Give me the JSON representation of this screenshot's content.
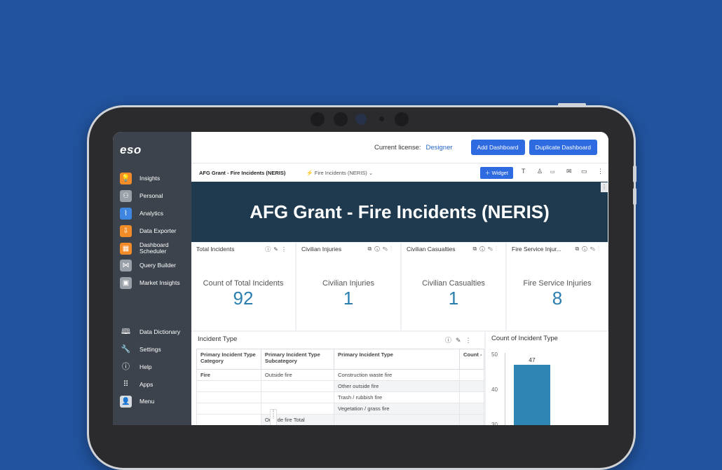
{
  "sidebar": {
    "logo": "eso",
    "items": [
      {
        "label": "Insights",
        "icon": "lightbulb-icon",
        "color": "#f28c28"
      },
      {
        "label": "Personal",
        "icon": "person-icon",
        "color": "#9aa0a8"
      },
      {
        "label": "Analytics",
        "icon": "analytics-icon",
        "color": "#3f86e0"
      },
      {
        "label": "Data Exporter",
        "icon": "export-icon",
        "color": "#f28c28"
      },
      {
        "label": "Dashboard Scheduler",
        "icon": "scheduler-icon",
        "color": "#f28c28"
      },
      {
        "label": "Query Builder",
        "icon": "query-icon",
        "color": "#9aa0a8"
      },
      {
        "label": "Market Insights",
        "icon": "market-icon",
        "color": "#9aa0a8"
      }
    ],
    "bottom_items": [
      {
        "label": "Data Dictionary",
        "icon": "book-icon"
      },
      {
        "label": "Settings",
        "icon": "wrench-icon"
      },
      {
        "label": "Help",
        "icon": "help-icon"
      },
      {
        "label": "Apps",
        "icon": "grid-icon"
      },
      {
        "label": "Menu",
        "icon": "avatar-icon"
      }
    ]
  },
  "topbar": {
    "license_label": "Current license:",
    "license_value": "Designer",
    "add_dashboard": "Add Dashboard",
    "duplicate_dashboard": "Duplicate Dashboard"
  },
  "tabbar": {
    "dashboard_title": "AFG Grant - Fire Incidents (NERIS)",
    "subtab": "Fire Incidents (NERIS)",
    "widget_button": "Widget"
  },
  "banner": {
    "title": "AFG Grant - Fire Incidents (NERIS)"
  },
  "kpis": [
    {
      "header": "Total Incidents",
      "label": "Count of Total Incidents",
      "value": "92"
    },
    {
      "header": "Civilian Injuries",
      "label": "Civilian Injuries",
      "value": "1"
    },
    {
      "header": "Civilian Casualties",
      "label": "Civilian Casualties",
      "value": "1"
    },
    {
      "header": "Fire Service Injur...",
      "label": "Fire Service Injuries",
      "value": "8"
    }
  ],
  "incident_table": {
    "title": "Incident Type",
    "columns": [
      "Primary Incident Type Category",
      "Primary Incident Type Subcategory",
      "Primary Incident Type",
      "Count - Incider"
    ],
    "rows": [
      {
        "category": "Fire",
        "subcategory": "Outside fire",
        "type": "Construction waste fire"
      },
      {
        "category": "",
        "subcategory": "",
        "type": "Other outside fire"
      },
      {
        "category": "",
        "subcategory": "",
        "type": "Trash / rubbish fire"
      },
      {
        "category": "",
        "subcategory": "",
        "type": "Vegetation / grass fire"
      },
      {
        "category": "",
        "subcategory": "Outside fire Total",
        "type": ""
      }
    ]
  },
  "chart_data": {
    "type": "bar",
    "title": "Count of Incident Type",
    "ylim": [
      30,
      50
    ],
    "yticks": [
      "50",
      "40",
      "30"
    ],
    "values": [
      47
    ],
    "data_labels": [
      "47"
    ],
    "color": "#2e86b5"
  }
}
